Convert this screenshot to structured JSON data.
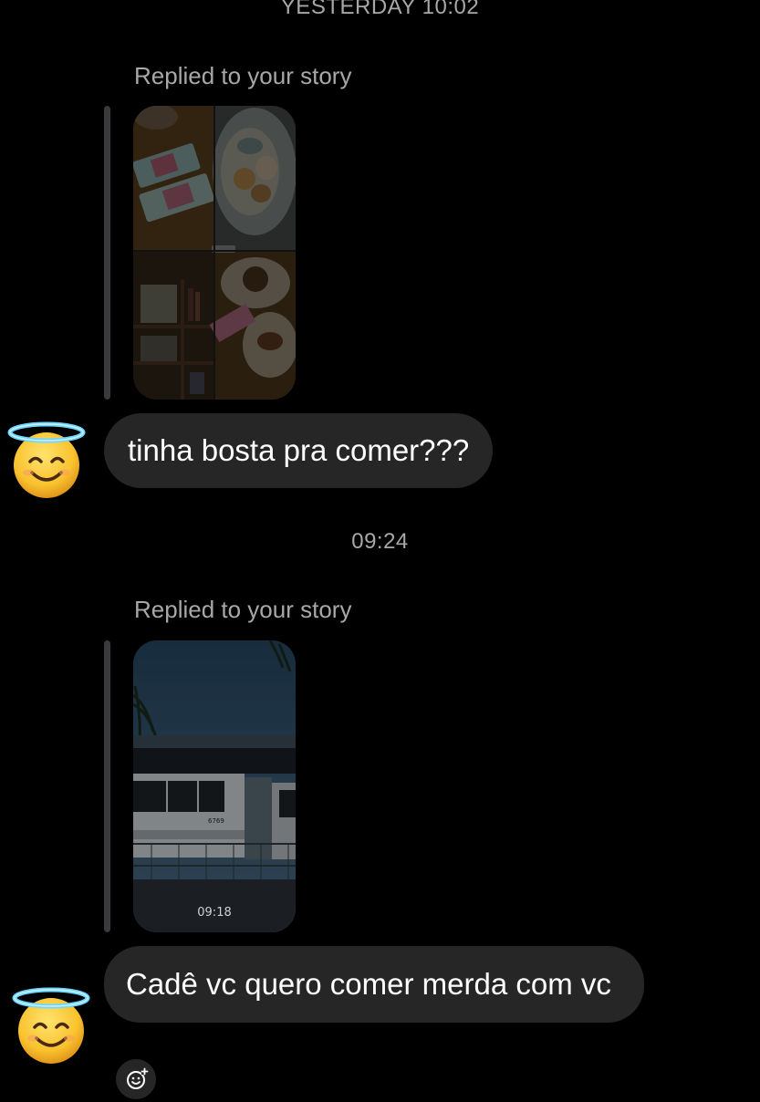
{
  "timestamps": {
    "top": "YESTERDAY 10:02",
    "middle": "09:24"
  },
  "messages": [
    {
      "reply_label": "Replied to your story",
      "story": {
        "description_icon": "story-collage-thumbnail"
      },
      "text": "tinha bosta pra comer???",
      "sender_avatar": "smiling-face-with-halo-emoji"
    },
    {
      "reply_label": "Replied to your story",
      "story": {
        "time_overlay": "09:18",
        "bus_number": "6769",
        "description_icon": "story-bus-thumbnail"
      },
      "text": "Cadê vc quero comer merda com vc",
      "sender_avatar": "smiling-face-with-halo-emoji"
    }
  ],
  "react_button": {
    "icon": "add-reaction-icon"
  },
  "colors": {
    "background": "#000000",
    "bubble": "#262626",
    "secondary_text": "#a8a8a8",
    "reply_bar": "#3a3a3c"
  }
}
